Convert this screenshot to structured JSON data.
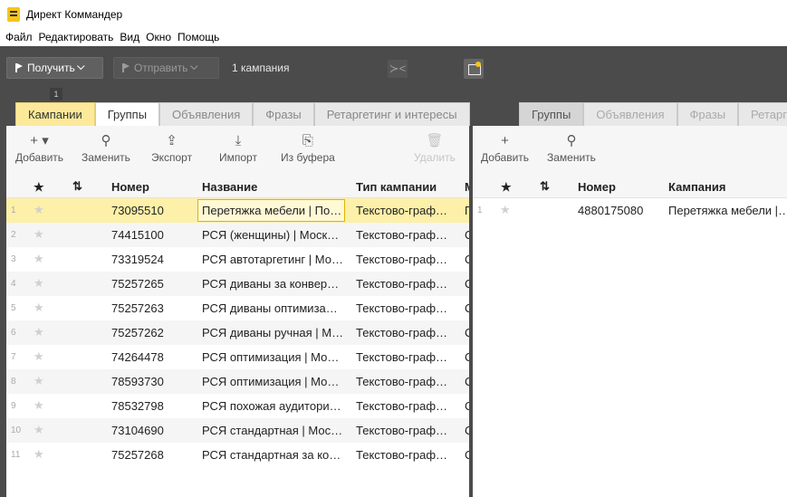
{
  "window": {
    "title": "Директ Коммандер"
  },
  "menu": [
    "Файл",
    "Редактировать",
    "Вид",
    "Окно",
    "Помощь"
  ],
  "toolbar": {
    "get_label": "Получить",
    "send_label": "Отправить",
    "campaigns_count": "1 кампания",
    "collapse_glyph": "≻<",
    "badge": "1"
  },
  "left": {
    "tabs": [
      "Кампании",
      "Группы",
      "Объявления",
      "Фразы",
      "Ретаргетинг и интересы"
    ],
    "actions": {
      "add": "Добавить",
      "replace": "Заменить",
      "export": "Экспорт",
      "import": "Импорт",
      "from_buffer": "Из буфера",
      "delete": "Удалить"
    },
    "columns": {
      "star": "★",
      "number": "Номер",
      "name": "Название",
      "type": "Тип кампании",
      "extra": "М"
    },
    "rows": [
      {
        "idx": "1",
        "number": "73095510",
        "name": "Перетяжка мебели | По…",
        "type": "Текстово-граф…",
        "extra": "П"
      },
      {
        "idx": "2",
        "number": "74415100",
        "name": "РСЯ (женщины) | Моск…",
        "type": "Текстово-граф…",
        "extra": "С"
      },
      {
        "idx": "3",
        "number": "73319524",
        "name": "РСЯ автотаргетинг | Мо…",
        "type": "Текстово-граф…",
        "extra": "С"
      },
      {
        "idx": "4",
        "number": "75257265",
        "name": "РСЯ диваны за конвер…",
        "type": "Текстово-граф…",
        "extra": "С"
      },
      {
        "idx": "5",
        "number": "75257263",
        "name": "РСЯ диваны оптимиза…",
        "type": "Текстово-граф…",
        "extra": "С"
      },
      {
        "idx": "6",
        "number": "75257262",
        "name": "РСЯ диваны ручная | М…",
        "type": "Текстово-граф…",
        "extra": "С"
      },
      {
        "idx": "7",
        "number": "74264478",
        "name": "РСЯ оптимизация | Мо…",
        "type": "Текстово-граф…",
        "extra": "С"
      },
      {
        "idx": "8",
        "number": "78593730",
        "name": "РСЯ оптимизация | Мо…",
        "type": "Текстово-граф…",
        "extra": "С"
      },
      {
        "idx": "9",
        "number": "78532798",
        "name": "РСЯ похожая аудитори…",
        "type": "Текстово-граф…",
        "extra": "С"
      },
      {
        "idx": "10",
        "number": "73104690",
        "name": "РСЯ стандартная | Мос…",
        "type": "Текстово-граф…",
        "extra": "С"
      },
      {
        "idx": "11",
        "number": "75257268",
        "name": "РСЯ стандартная за ко…",
        "type": "Текстово-граф…",
        "extra": "С"
      }
    ]
  },
  "right": {
    "tabs": [
      "Группы",
      "Объявления",
      "Фразы",
      "Ретаргет"
    ],
    "actions": {
      "add": "Добавить",
      "replace": "Заменить"
    },
    "columns": {
      "star": "★",
      "number": "Номер",
      "campaign": "Кампания"
    },
    "rows": [
      {
        "idx": "1",
        "number": "4880175080",
        "campaign": "Перетяжка мебели |…"
      }
    ]
  }
}
